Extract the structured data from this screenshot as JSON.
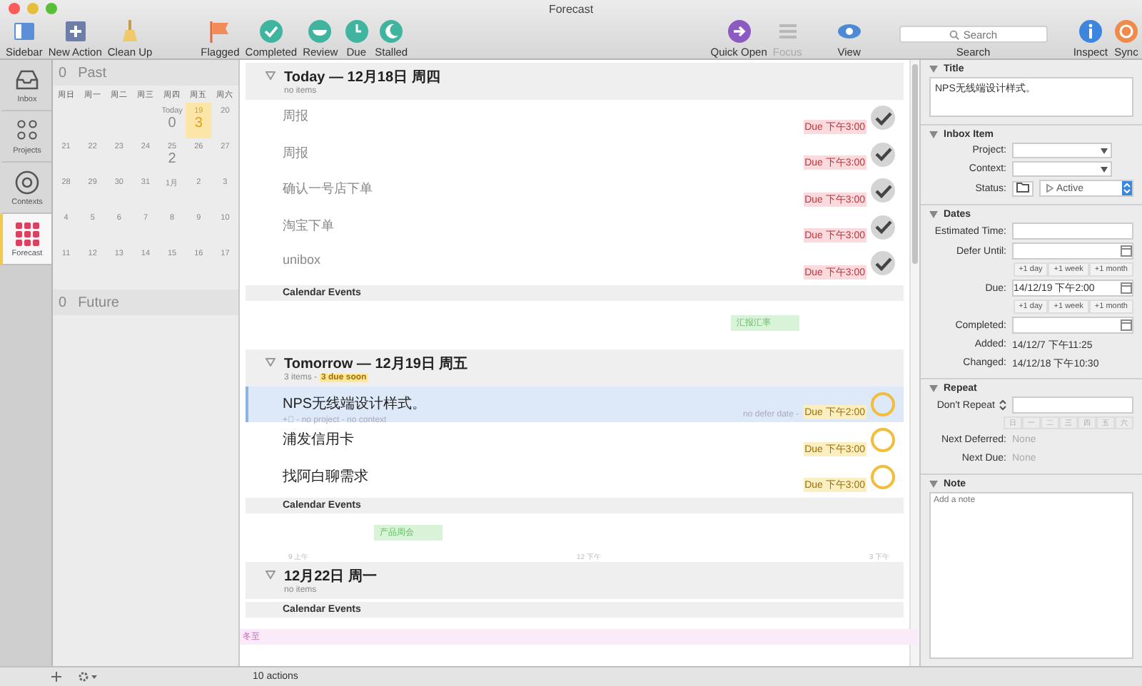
{
  "window": {
    "title": "Forecast"
  },
  "toolbar": {
    "left": [
      {
        "label": "Sidebar",
        "kind": "sidebar",
        "disabled": false
      },
      {
        "label": "New Action",
        "kind": "new",
        "disabled": false
      },
      {
        "label": "Clean Up",
        "kind": "broom",
        "disabled": false
      }
    ],
    "perspectives": [
      {
        "label": "Flagged",
        "kind": "flag",
        "disabled": false
      },
      {
        "label": "Completed",
        "kind": "check",
        "disabled": false
      },
      {
        "label": "Review",
        "kind": "cup",
        "disabled": false
      },
      {
        "label": "Due",
        "kind": "clock",
        "disabled": false
      },
      {
        "label": "Stalled",
        "kind": "moon",
        "disabled": false
      }
    ],
    "right": [
      {
        "label": "Quick Open",
        "kind": "arrow",
        "disabled": false
      },
      {
        "label": "Focus",
        "kind": "focus",
        "disabled": true
      },
      {
        "label": "View",
        "kind": "eye",
        "disabled": false
      }
    ],
    "search": {
      "placeholder": "Search",
      "label": "Search"
    },
    "end": [
      {
        "label": "Inspect",
        "kind": "info",
        "disabled": false
      },
      {
        "label": "Sync",
        "kind": "sync",
        "disabled": false
      }
    ]
  },
  "sidebar_tabs": [
    {
      "label": "Inbox",
      "kind": "inbox",
      "selected": false
    },
    {
      "label": "Projects",
      "kind": "projects",
      "selected": false
    },
    {
      "label": "Contexts",
      "kind": "at",
      "selected": false
    },
    {
      "label": "Forecast",
      "kind": "grid",
      "selected": true
    }
  ],
  "calendar": {
    "past": {
      "count": "0",
      "label": "Past"
    },
    "weekdays": [
      "周日",
      "周一",
      "周二",
      "周三",
      "周四",
      "周五",
      "周六"
    ],
    "days": [
      {
        "kind": "blank"
      },
      {
        "kind": "blank"
      },
      {
        "kind": "blank"
      },
      {
        "kind": "blank"
      },
      {
        "kind": "day",
        "label": "Today",
        "count": "0",
        "selected": false
      },
      {
        "kind": "day",
        "label": "19",
        "count": "3",
        "selected": true
      },
      {
        "kind": "day",
        "label": "20",
        "selected": false
      },
      {
        "kind": "day",
        "label": "21",
        "selected": false
      },
      {
        "kind": "day",
        "label": "22",
        "selected": false
      },
      {
        "kind": "day",
        "label": "23",
        "selected": false
      },
      {
        "kind": "day",
        "label": "24",
        "selected": false
      },
      {
        "kind": "day",
        "label": "25",
        "count": "2",
        "selected": false
      },
      {
        "kind": "day",
        "label": "26",
        "selected": false
      },
      {
        "kind": "day",
        "label": "27",
        "selected": false
      },
      {
        "kind": "day",
        "label": "28",
        "selected": false
      },
      {
        "kind": "day",
        "label": "29",
        "selected": false
      },
      {
        "kind": "day",
        "label": "30",
        "selected": false
      },
      {
        "kind": "day",
        "label": "31",
        "selected": false
      },
      {
        "kind": "day",
        "label": "1月",
        "selected": false
      },
      {
        "kind": "day",
        "label": "2",
        "selected": false
      },
      {
        "kind": "day",
        "label": "3",
        "selected": false
      },
      {
        "kind": "day",
        "label": "4",
        "selected": false
      },
      {
        "kind": "day",
        "label": "5",
        "selected": false
      },
      {
        "kind": "day",
        "label": "6",
        "selected": false
      },
      {
        "kind": "day",
        "label": "7",
        "selected": false
      },
      {
        "kind": "day",
        "label": "8",
        "selected": false
      },
      {
        "kind": "day",
        "label": "9",
        "selected": false
      },
      {
        "kind": "day",
        "label": "10",
        "selected": false
      },
      {
        "kind": "day",
        "label": "11",
        "selected": false
      },
      {
        "kind": "day",
        "label": "12",
        "selected": false
      },
      {
        "kind": "day",
        "label": "13",
        "selected": false
      },
      {
        "kind": "day",
        "label": "14",
        "selected": false
      },
      {
        "kind": "day",
        "label": "15",
        "selected": false
      },
      {
        "kind": "day",
        "label": "16",
        "selected": false
      },
      {
        "kind": "day",
        "label": "17",
        "selected": false
      }
    ],
    "future": {
      "count": "0",
      "label": "Future"
    }
  },
  "sections": [
    {
      "title": "Today — 12月18日 周四",
      "subtitle": "no items",
      "items": [
        {
          "title": "周报",
          "due": "Due 下午3:00",
          "completed": true,
          "overdue": true,
          "selected": false
        },
        {
          "title": "周报",
          "due": "Due 下午3:00",
          "completed": true,
          "overdue": true,
          "selected": false
        },
        {
          "title": "确认一号店下单",
          "due": "Due 下午3:00",
          "completed": true,
          "overdue": true,
          "selected": false
        },
        {
          "title": "淘宝下单",
          "due": "Due 下午3:00",
          "completed": true,
          "overdue": true,
          "selected": false
        },
        {
          "title": "unibox",
          "due": "Due 下午3:00",
          "completed": true,
          "overdue": true,
          "selected": false
        }
      ],
      "calendar_label": "Calendar Events",
      "events": [
        {
          "title": "汇报汇率",
          "color": "#d8f3d8"
        }
      ]
    },
    {
      "title": "Tomorrow — 12月19日 周五",
      "subtitle": "3 items -",
      "badge": "3 due soon",
      "items": [
        {
          "title": "NPS无线端设计样式。",
          "meta": "+⃞ - no project - no context",
          "defer": "no defer date -",
          "due": "Due 下午2:00",
          "completed": false,
          "overdue": false,
          "selected": true
        },
        {
          "title": "浦发信用卡",
          "due": "Due 下午3:00",
          "completed": false,
          "overdue": false,
          "selected": false
        },
        {
          "title": "找阿白聊需求",
          "due": "Due 下午3:00",
          "completed": false,
          "overdue": false,
          "selected": false
        }
      ],
      "calendar_label": "Calendar Events",
      "events": [
        {
          "title": "产品周会",
          "color": "#d8f3d8"
        }
      ],
      "times": [
        "9 上午",
        "12 下午",
        "3 下午"
      ]
    },
    {
      "title": "12月22日 周一",
      "subtitle": "no items",
      "calendar_label": "Calendar Events",
      "allday": "冬至"
    }
  ],
  "status_bar": {
    "text": "10 actions"
  },
  "inspector": {
    "title": {
      "heading": "Title",
      "value": "NPS无线端设计样式。"
    },
    "inbox": {
      "heading": "Inbox Item",
      "project_label": "Project:",
      "context_label": "Context:",
      "status_label": "Status:",
      "status": "Active"
    },
    "dates": {
      "heading": "Dates",
      "estimated_label": "Estimated Time:",
      "defer_label": "Defer Until:",
      "due_label": "Due:",
      "due_value": "14/12/19 下午2:00",
      "completed_label": "Completed:",
      "added_label": "Added:",
      "added": "14/12/7 下午11:25",
      "changed_label": "Changed:",
      "changed": "14/12/18 下午10:30",
      "defer_quick": [
        "+1 day",
        "+1 week",
        "+1 month"
      ],
      "due_quick": [
        "+1 day",
        "+1 week",
        "+1 month"
      ]
    },
    "repeat": {
      "heading": "Repeat",
      "mode": "Don't Repeat",
      "weekdays": [
        "日",
        "一",
        "二",
        "三",
        "四",
        "五",
        "六"
      ],
      "next_deferred_label": "Next Deferred:",
      "next_deferred": "None",
      "next_due_label": "Next Due:",
      "next_due": "None"
    },
    "note": {
      "heading": "Note",
      "placeholder": "Add a note"
    }
  }
}
